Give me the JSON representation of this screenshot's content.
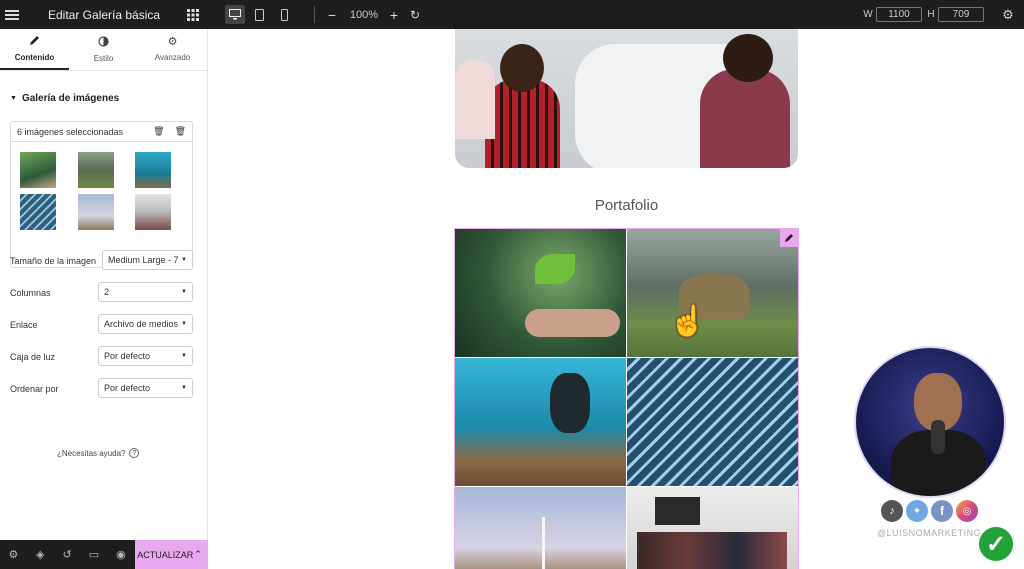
{
  "topbar": {
    "title": "Editar Galería básica",
    "zoom": "100%",
    "w_label": "W",
    "w_value": "1100",
    "h_label": "H",
    "h_value": "709"
  },
  "tabs": [
    {
      "label": "Contenido"
    },
    {
      "label": "Estilo"
    },
    {
      "label": "Avanzado"
    }
  ],
  "section": {
    "title": "Galería de imágenes"
  },
  "gallery": {
    "count_text": "6 imágenes seleccionadas"
  },
  "controls": [
    {
      "label": "Tamaño de la imagen",
      "value": "Medium Large - 7"
    },
    {
      "label": "Columnas",
      "value": "2"
    },
    {
      "label": "Enlace",
      "value": "Archivo de medios"
    },
    {
      "label": "Caja de luz",
      "value": "Por defecto"
    },
    {
      "label": "Ordenar por",
      "value": "Por defecto"
    }
  ],
  "help": {
    "text": "¿Necesitas ayuda?"
  },
  "bottom": {
    "update_label": "ACTUALIZAR"
  },
  "page": {
    "heading": "Portafolio"
  },
  "overlay": {
    "handle": "@LUISNOMARKETING"
  },
  "colors": {
    "accent": "#e9a8f0",
    "dark": "#1e1e1e",
    "success": "#22a33a"
  }
}
